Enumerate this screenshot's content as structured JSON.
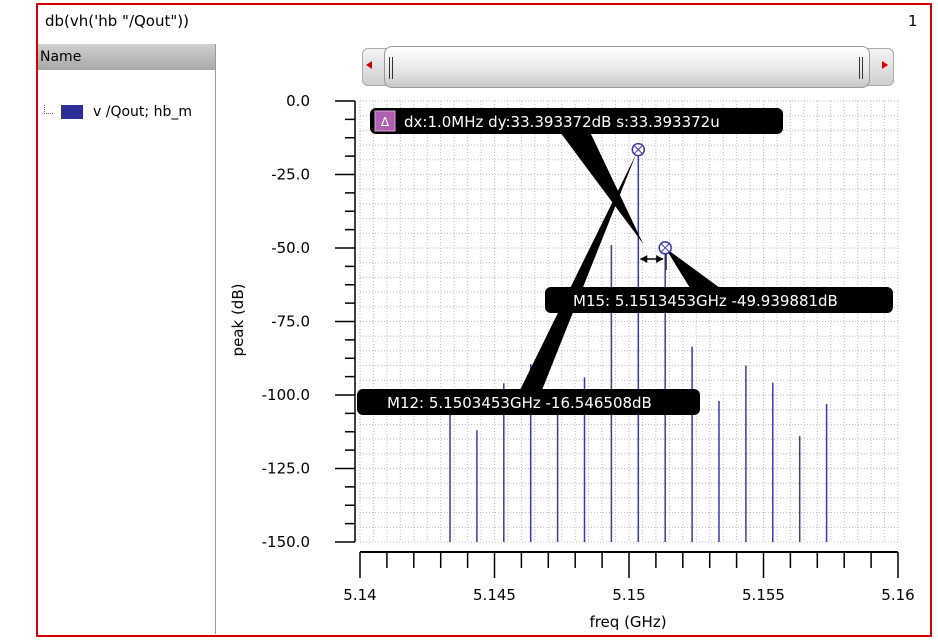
{
  "window": {
    "title": "db(vh('hb \"/Qout\"))",
    "page_number": "1"
  },
  "panel": {
    "header": "Name",
    "items": [
      {
        "label": "v /Qout; hb_m",
        "color": "#2e2e9a"
      }
    ]
  },
  "chart_data": {
    "type": "bar",
    "subtype": "stem",
    "xlabel": "freq (GHz)",
    "ylabel": "peak (dB)",
    "xlim": [
      5.14,
      5.16
    ],
    "ylim": [
      -150,
      0
    ],
    "xticks": [
      "5.14",
      "5.145",
      "5.15",
      "5.155",
      "5.16"
    ],
    "yticks": [
      "0.0",
      "-25.0",
      "-50.0",
      "-75.0",
      "-100.0",
      "-125.0",
      "-150.0"
    ],
    "grid": true,
    "series_color": "#3a3aa8",
    "x": [
      5.1433453,
      5.1443453,
      5.1453453,
      5.1463453,
      5.1473453,
      5.1483453,
      5.1493453,
      5.1503453,
      5.1513453,
      5.1523453,
      5.1533453,
      5.1543453,
      5.1553453,
      5.1563453,
      5.1573453
    ],
    "values": [
      -105,
      -112,
      -96,
      -89.5,
      -103,
      -94,
      -49,
      -16.546508,
      -49.939881,
      -83.6,
      -102,
      -90,
      -95.8,
      -114,
      -103
    ],
    "markers": [
      {
        "label": "M12: 5.1503453GHz -16.546508dB",
        "x": 5.1503453,
        "y": -16.546508
      },
      {
        "label": "M15: 5.1513453GHz -49.939881dB",
        "x": 5.1513453,
        "y": -49.939881
      }
    ],
    "delta": {
      "icon": "Δ",
      "label": "dx:1.0MHz dy:33.393372dB s:33.393372u"
    }
  }
}
